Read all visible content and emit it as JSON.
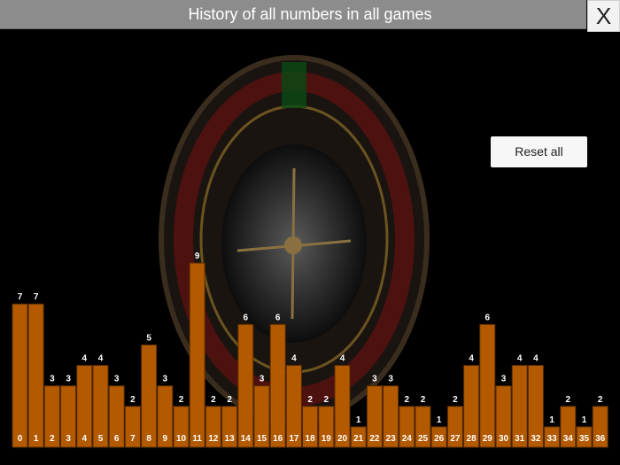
{
  "window": {
    "title": "History of all numbers in all games",
    "close_label": "X"
  },
  "controls": {
    "reset_label": "Reset all"
  },
  "colors": {
    "bar": "#b35a00",
    "title_bar": "#8c8c8c",
    "background": "#000000"
  },
  "chart_data": {
    "type": "bar",
    "categories": [
      "0",
      "1",
      "2",
      "3",
      "4",
      "5",
      "6",
      "7",
      "8",
      "9",
      "10",
      "11",
      "12",
      "13",
      "14",
      "15",
      "16",
      "17",
      "18",
      "19",
      "20",
      "21",
      "22",
      "23",
      "24",
      "25",
      "26",
      "27",
      "28",
      "29",
      "30",
      "31",
      "32",
      "33",
      "34",
      "35",
      "36"
    ],
    "values": [
      7,
      7,
      3,
      3,
      4,
      4,
      3,
      2,
      5,
      3,
      2,
      9,
      2,
      2,
      6,
      3,
      6,
      4,
      2,
      2,
      4,
      1,
      3,
      3,
      2,
      2,
      1,
      2,
      4,
      6,
      3,
      4,
      4,
      1,
      2,
      1,
      2
    ],
    "title": "",
    "xlabel": "",
    "ylabel": "",
    "ylim": [
      0,
      9
    ],
    "grid": false,
    "data_labels": true
  }
}
